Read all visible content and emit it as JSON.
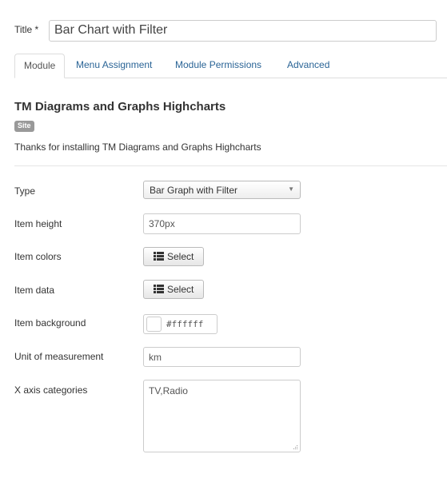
{
  "title": {
    "label": "Title *",
    "value": "Bar Chart with Filter"
  },
  "tabs": [
    {
      "label": "Module",
      "active": true
    },
    {
      "label": "Menu Assignment",
      "active": false
    },
    {
      "label": "Module Permissions",
      "active": false
    },
    {
      "label": "Advanced",
      "active": false
    }
  ],
  "module": {
    "heading": "TM Diagrams and Graphs Highcharts",
    "badge": "Site",
    "description": "Thanks for installing TM Diagrams and Graphs Highcharts"
  },
  "form": {
    "type": {
      "label": "Type",
      "value": "Bar Graph with Filter"
    },
    "item_height": {
      "label": "Item height",
      "value": "370px"
    },
    "item_colors": {
      "label": "Item colors",
      "button": "Select"
    },
    "item_data": {
      "label": "Item data",
      "button": "Select"
    },
    "item_background": {
      "label": "Item background",
      "value": "#ffffff"
    },
    "unit": {
      "label": "Unit of measurement",
      "value": "km"
    },
    "x_axis": {
      "label": "X axis categories",
      "value": "TV,Radio"
    }
  },
  "colors": {
    "tab_link": "#2a6496",
    "badge_bg": "#999999",
    "border": "#cccccc"
  },
  "icons": {
    "list": "list-icon",
    "caret": "caret-down-icon",
    "resize": "resize-grip-icon"
  }
}
